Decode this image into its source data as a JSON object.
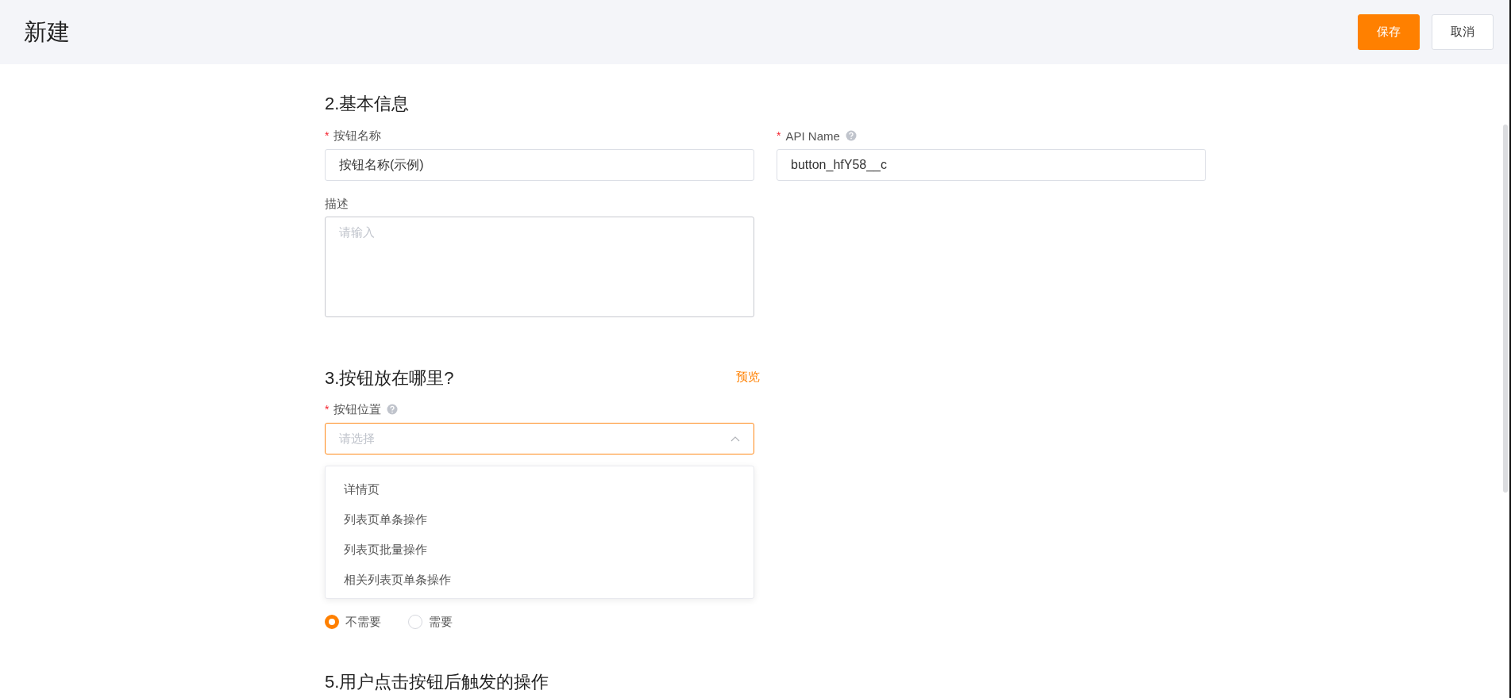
{
  "header": {
    "title": "新建",
    "buttons": [
      {
        "label": "保存",
        "kind": "primary"
      },
      {
        "label": "取消",
        "kind": "default"
      }
    ]
  },
  "basic_info": {
    "title": "2.基本信息",
    "fields": [
      {
        "required_mark": "*",
        "label": "按钮名称",
        "help": false,
        "value": "按钮名称(示例)"
      },
      {
        "required_mark": "*",
        "label": "API Name",
        "help": true,
        "value": "button_hfY58__c"
      }
    ],
    "description": {
      "label": "描述",
      "placeholder": "请输入"
    }
  },
  "placement": {
    "title": "3.按钮放在哪里?",
    "preview_link": "预览",
    "field": {
      "required_mark": "*",
      "label": "按钮位置",
      "help": true,
      "placeholder": "请选择",
      "expanded": true
    },
    "options": [
      {
        "label": "详情页"
      },
      {
        "label": "列表页单条操作"
      },
      {
        "label": "列表页批量操作"
      },
      {
        "label": "相关列表页单条操作"
      }
    ]
  },
  "radios": [
    {
      "label": "不需要",
      "selected": true
    },
    {
      "label": "需要",
      "selected": false
    }
  ],
  "next_section": {
    "title": "5.用户点击按钮后触发的操作"
  }
}
